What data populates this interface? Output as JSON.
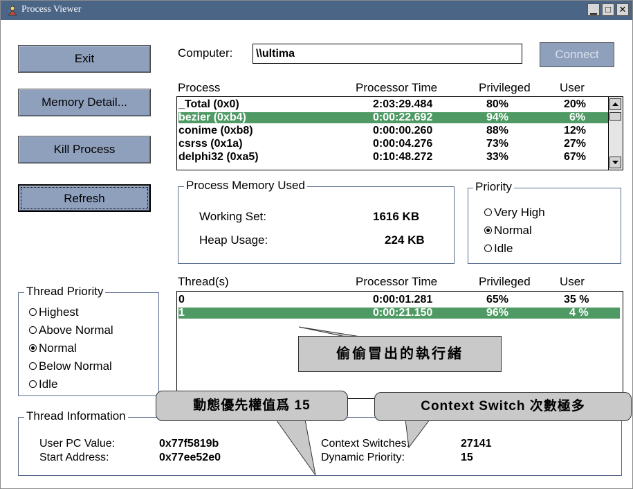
{
  "window": {
    "title": "Process Viewer"
  },
  "buttons": {
    "exit": "Exit",
    "memory_detail": "Memory Detail...",
    "kill_process": "Kill Process",
    "refresh": "Refresh"
  },
  "computer": {
    "label": "Computer:",
    "value": "\\\\ultima",
    "connect": "Connect"
  },
  "process_list": {
    "headers": {
      "process": "Process",
      "processor_time": "Processor Time",
      "privileged": "Privileged",
      "user": "User"
    },
    "rows": [
      {
        "name": "_Total (0x0)",
        "time": "2:03:29.484",
        "priv": "80%",
        "user": "20%"
      },
      {
        "name": "bezier (0xb4)",
        "time": "0:00:22.692",
        "priv": "94%",
        "user": "6%"
      },
      {
        "name": "conime (0xb8)",
        "time": "0:00:00.260",
        "priv": "88%",
        "user": "12%"
      },
      {
        "name": "csrss (0x1a)",
        "time": "0:00:04.276",
        "priv": "73%",
        "user": "27%"
      },
      {
        "name": "delphi32 (0xa5)",
        "time": "0:10:48.272",
        "priv": "33%",
        "user": "67%"
      }
    ]
  },
  "memory": {
    "title": "Process Memory Used",
    "working_set_label": "Working Set:",
    "working_set_value": "1616 KB",
    "heap_label": "Heap Usage:",
    "heap_value": "224 KB"
  },
  "priority": {
    "title": "Priority",
    "options": [
      "Very High",
      "Normal",
      "Idle"
    ],
    "selected": "Normal"
  },
  "threads": {
    "headers": {
      "threads": "Thread(s)",
      "processor_time": "Processor Time",
      "privileged": "Privileged",
      "user": "User"
    },
    "rows": [
      {
        "id": "0",
        "time": "0:00:01.281",
        "priv": "65%",
        "user": "35 %"
      },
      {
        "id": "1",
        "time": "0:00:21.150",
        "priv": "96%",
        "user": "4 %"
      }
    ]
  },
  "thread_priority": {
    "title": "Thread Priority",
    "options": [
      "Highest",
      "Above Normal",
      "Normal",
      "Below Normal",
      "Idle"
    ],
    "selected": "Normal"
  },
  "thread_info": {
    "title": "Thread Information",
    "user_pc_label": "User PC Value:",
    "user_pc_value": "0x77f5819b",
    "start_addr_label": "Start Address:",
    "start_addr_value": "0x77ee52e0",
    "context_label": "Context Switches:",
    "context_value": "27141",
    "dyn_prio_label": "Dynamic Priority:",
    "dyn_prio_value": "15"
  },
  "callouts": {
    "thread": "偷偷冒出的執行緒",
    "dynamic": "動態優先權值爲 15",
    "context": "Context Switch 次數極多"
  },
  "colors": {
    "titlebar": "#4a6586",
    "button": "#8fa0bd",
    "selection": "#4f9a64",
    "callout": "#c9c9c9"
  }
}
